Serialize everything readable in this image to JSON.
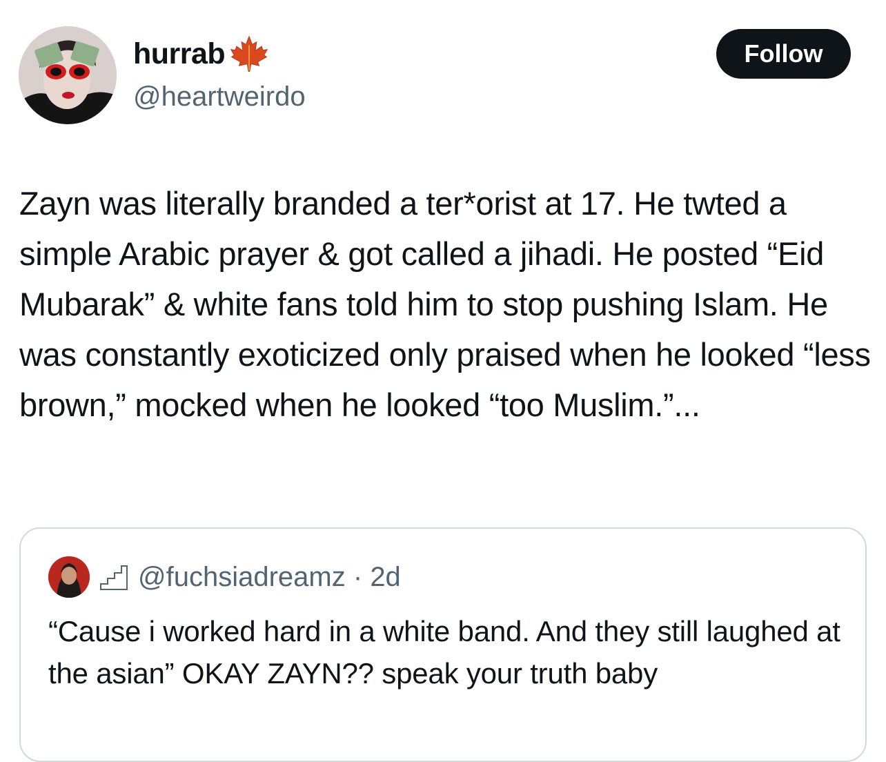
{
  "author": {
    "display_name": "hurrab",
    "handle": "@heartweirdo",
    "badge_icon": "maple-leaf-icon"
  },
  "follow_button": {
    "label": "Follow"
  },
  "tweet": {
    "text": "Zayn was literally branded a ter*orist at 17. He twted a simple Arabic prayer & got called a jihadi. He posted “Eid Mubarak” & white fans told him to stop pushing Islam. He was constantly exoticized only praised when he looked “less brown,” mocked when he looked “too Muslim.”..."
  },
  "quoted_tweet": {
    "handle": "@fuchsiadreamz",
    "separator": "·",
    "time": "2d",
    "badge_icon": "stairs-icon",
    "text": "“Cause i worked hard in a white band. And they still laughed at the asian” OKAY ZAYN?? speak your truth baby"
  },
  "colors": {
    "text_primary": "#0f1419",
    "text_secondary": "#536471",
    "button_bg": "#0f1419",
    "button_text": "#ffffff",
    "card_border": "#cfd9de"
  }
}
